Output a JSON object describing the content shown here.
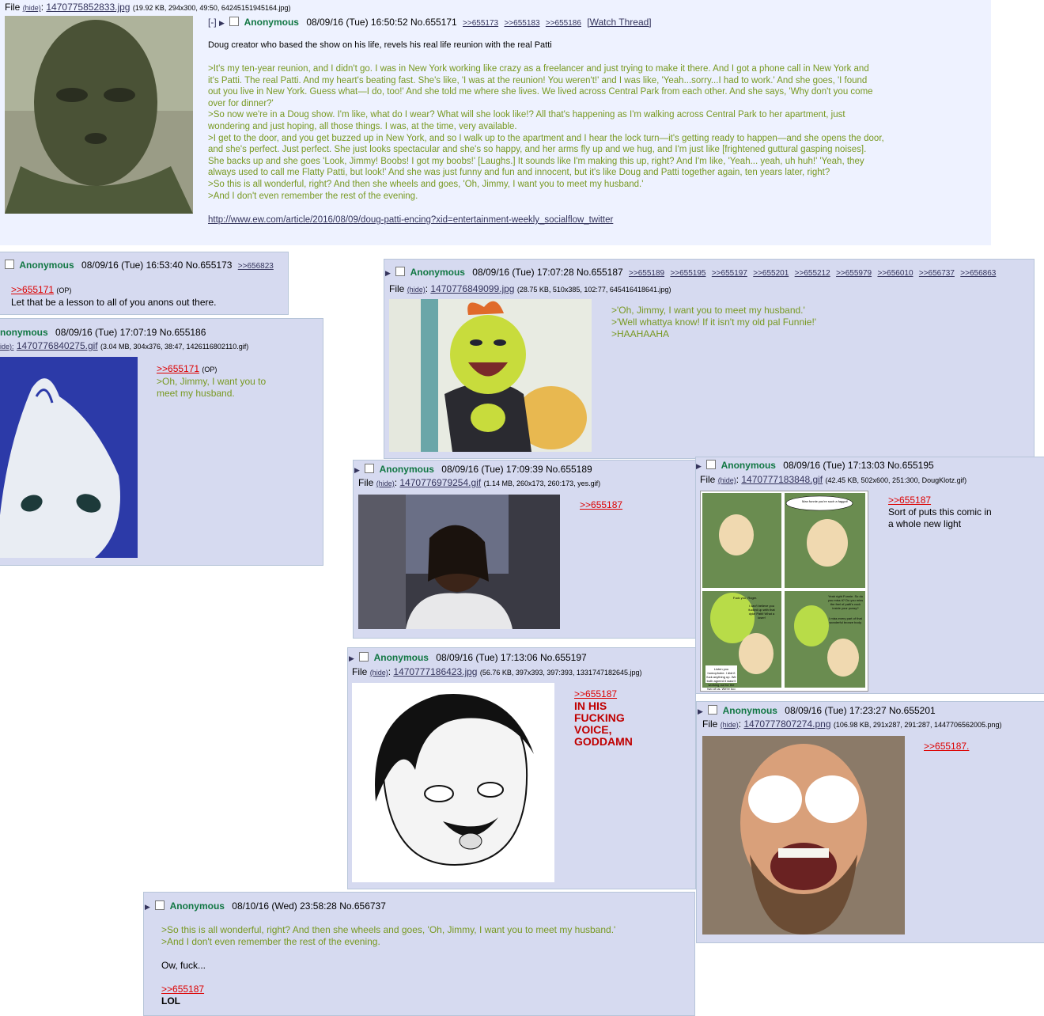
{
  "op": {
    "file_label": "File",
    "hide": "(hide)",
    "filename": "1470775852833.jpg",
    "fileinfo": "(19.92 KB, 294x300, 49:50, 64245151945164.jpg)",
    "expand": "[-]",
    "name": "Anonymous",
    "datetime": "08/09/16 (Tue) 16:50:52",
    "no": "No.655171",
    "quotelinks": [
      ">>655173",
      ">>655183",
      ">>655186"
    ],
    "watch": "[Watch Thread]",
    "subject": "Doug creator who based the show on his life, revels his real life reunion with the real Patti",
    "lines": [
      ">It's my ten-year reunion, and I didn't go. I was in New York working like crazy as a freelancer and just trying to make it there. And I got a phone call in New York and",
      "it's Patti. The real Patti. And my heart's beating fast. She's like, 'I was at the reunion! You weren't!' and I was like, 'Yeah...sorry...I had to work.' And she goes, 'I found",
      "out you live in New York. Guess what—I do, too!' And she told me where she lives. We lived across Central Park from each other. And she says, 'Why don't you come",
      "over for dinner?'",
      ">So now we're in a Doug show. I'm like, what do I wear? What will she look like!? All that's happening as I'm walking across Central Park to her apartment, just",
      "wondering and just hoping, all those things. I was, at the time, very available.",
      ">I get to the door, and you get buzzed up in New York, and so I walk up to the apartment and I hear the lock turn—it's getting ready to happen—and she opens the door,",
      "and she's perfect. Just perfect. She just looks spectacular and she's so happy, and her arms fly up and we hug, and I'm just like [frightened guttural gasping noises].",
      "She backs up and she goes 'Look, Jimmy! Boobs! I got my boobs!' [Laughs.] It sounds like I'm making this up, right? And I'm like, 'Yeah... yeah, uh huh!' 'Yeah, they",
      "always used to call me Flatty Patti, but look!' And she was just funny and fun and innocent, but it's like Doug and Patti together again, ten years later, right?",
      ">So this is all wonderful, right? And then she wheels and goes, 'Oh, Jimmy, I want you to meet my husband.'",
      ">And I don't even remember the rest of the evening."
    ],
    "url": "http://www.ew.com/article/2016/08/09/doug-patti-encing?xid=entertainment-weekly_socialflow_twitter"
  },
  "p173": {
    "name": "Anonymous",
    "datetime": "08/09/16 (Tue) 16:53:40",
    "no": "No.655173",
    "quotelink": ">>656823",
    "ref": ">>655171",
    "op_tag": "(OP)",
    "text": "Let that be a lesson to all of you anons out there."
  },
  "p186": {
    "name": "nonymous",
    "datetime": "08/09/16 (Tue) 17:07:19",
    "no": "No.655186",
    "hide": "ide):",
    "filename": "1470776840275.gif",
    "fileinfo": "(3.04 MB, 304x376, 38:47, 1426116802110.gif)",
    "ref": ">>655171",
    "op_tag": "(OP)",
    "line1": ">Oh, Jimmy, I want you to",
    "line2": "meet my husband."
  },
  "p187": {
    "name": "Anonymous",
    "datetime": "08/09/16 (Tue) 17:07:28",
    "no": "No.655187",
    "quotelinks": [
      ">>655189",
      ">>655195",
      ">>655197",
      ">>655201",
      ">>655212",
      ">>655979",
      ">>656010",
      ">>656737",
      ">>656863"
    ],
    "file_label": "File",
    "hide": "(hide)",
    "filename": "1470776849099.jpg",
    "fileinfo": "(28.75 KB, 510x385, 102:77, 645416418641.jpg)",
    "lines": [
      ">'Oh, Jimmy, I want you to meet my husband.'",
      ">'Well whattya know! If it isn't my old pal Funnie!'",
      ">HAAHAAHA"
    ]
  },
  "p189": {
    "name": "Anonymous",
    "datetime": "08/09/16 (Tue) 17:09:39",
    "no": "No.655189",
    "file_label": "File",
    "hide": "(hide)",
    "filename": "1470776979254.gif",
    "fileinfo": "(1.14 MB, 260x173, 260:173, yes.gif)",
    "ref": ">>655187"
  },
  "p195": {
    "name": "Anonymous",
    "datetime": "08/09/16 (Tue) 17:13:03",
    "no": "No.655195",
    "file_label": "File",
    "hide": "(hide)",
    "filename": "1470777183848.gif",
    "fileinfo": "(42.45 KB, 502x600, 251:300, DougKlotz.gif)",
    "ref": ">>655187",
    "line1": "Sort of puts this comic in",
    "line2": "a whole new light",
    "comic_bubble1": "Man funnie you're such a faggot!",
    "comic_bubble2": "Fuck you, Roger.",
    "comic_bubble3": "I can't believe you fucked up with that dyke Patti! What a loser!",
    "comic_bubble4": "Yeah right Funnie. So do you miss it? Do you miss the feel of patti's cock inside your pussy?",
    "comic_bubble5": "I miss every part of that wonderful bronze body.",
    "comic_bubble6": "Listen you homophobe. I didn't fuck anything up. We both agreed it wasn't working out for the two of us. We're too different."
  },
  "p197": {
    "name": "Anonymous",
    "datetime": "08/09/16 (Tue) 17:13:06",
    "no": "No.655197",
    "file_label": "File",
    "hide": "(hide)",
    "filename": "1470777186423.jpg",
    "fileinfo": "(56.76 KB, 397x393, 397:393, 1331747182645.jpg)",
    "ref": ">>655187",
    "lines": [
      "IN HIS",
      "FUCKING",
      "VOICE,",
      "GODDAMN"
    ]
  },
  "p201": {
    "name": "Anonymous",
    "datetime": "08/09/16 (Tue) 17:23:27",
    "no": "No.655201",
    "file_label": "File",
    "hide": "(hide)",
    "filename": "1470777807274.png",
    "fileinfo": "(106.98 KB, 291x287, 291:287, 1447706562005.png)",
    "ref": ">>655187."
  },
  "p737": {
    "name": "Anonymous",
    "datetime": "08/10/16 (Wed) 23:58:28",
    "no": "No.656737",
    "line1": ">So this is all wonderful, right? And then she wheels and goes, 'Oh, Jimmy, I want you to meet my husband.'",
    "line2": ">And I don't even remember the rest of the evening.",
    "line3": "Ow, fuck...",
    "ref": ">>655187",
    "lol": "LOL"
  }
}
